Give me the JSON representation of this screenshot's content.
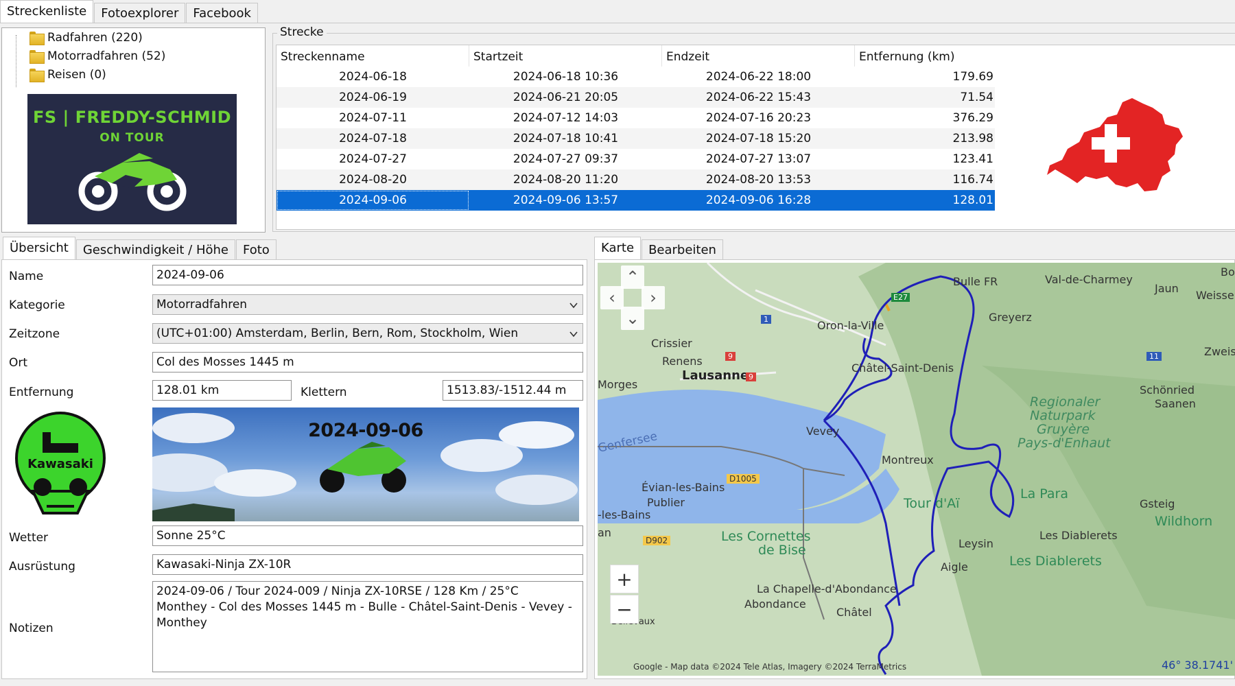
{
  "top_tabs": [
    "Streckenliste",
    "Fotoexplorer",
    "Facebook"
  ],
  "tree": {
    "items": [
      "Radfahren (220)",
      "Motorradfahren (52)",
      "Reisen (0)"
    ]
  },
  "brand": {
    "line1": "FS | FREDDY-SCHMID",
    "line2": "ON TOUR"
  },
  "strecke": {
    "group_title": "Strecke",
    "columns": [
      "Streckenname",
      "Startzeit",
      "Endzeit",
      "Entfernung (km)"
    ],
    "rows": [
      [
        "2024-06-18",
        "2024-06-18 10:36",
        "2024-06-22 18:00",
        "179.69"
      ],
      [
        "2024-06-19",
        "2024-06-21 20:05",
        "2024-06-22 15:43",
        "71.54"
      ],
      [
        "2024-07-11",
        "2024-07-12 14:03",
        "2024-07-16 20:23",
        "376.29"
      ],
      [
        "2024-07-18",
        "2024-07-18 10:41",
        "2024-07-18 15:20",
        "213.98"
      ],
      [
        "2024-07-27",
        "2024-07-27 09:37",
        "2024-07-27 13:07",
        "123.41"
      ],
      [
        "2024-08-20",
        "2024-08-20 11:20",
        "2024-08-20 13:53",
        "116.74"
      ],
      [
        "2024-09-06",
        "2024-09-06 13:57",
        "2024-09-06 16:28",
        "128.01"
      ]
    ],
    "selected_index": 6
  },
  "detail_tabs": [
    "Übersicht",
    "Geschwindigkeit / Höhe",
    "Foto"
  ],
  "detail": {
    "name_label": "Name",
    "name_value": "2024-09-06",
    "kategorie_label": "Kategorie",
    "kategorie_value": "Motorradfahren",
    "zeitzone_label": "Zeitzone",
    "zeitzone_value": "(UTC+01:00) Amsterdam, Berlin, Bern, Rom, Stockholm, Wien",
    "ort_label": "Ort",
    "ort_value": "Col des Mosses 1445 m",
    "entfernung_label": "Entfernung",
    "entfernung_value": "128.01 km",
    "klettern_label": "Klettern",
    "klettern_value": "1513.83/-1512.44 m",
    "banner_title": "2024-09-06",
    "kawasaki_text": "Kawasaki",
    "wetter_label": "Wetter",
    "wetter_value": "Sonne 25°C",
    "ausruestung_label": "Ausrüstung",
    "ausruestung_value": "Kawasaki-Ninja ZX-10R",
    "notizen_label": "Notizen",
    "notizen_line1": "2024-09-06 / Tour 2024-009 / Ninja ZX-10RSE / 128 Km / 25°C",
    "notizen_line2": "Monthey - Col des Mosses 1445 m - Bulle - Châtel-Saint-Denis - Vevey - Monthey"
  },
  "map_tabs": [
    "Karte",
    "Bearbeiten"
  ],
  "map": {
    "places": {
      "bulle": "Bulle FR",
      "val_de_charmey": "Val-de-Charmey",
      "jaun": "Jaun",
      "weissenb": "Weissenb",
      "bol": "Bol",
      "greyerz": "Greyerz",
      "oron": "Oron-la-Ville",
      "crissier": "Crissier",
      "renens": "Renens",
      "lausanne": "Lausanne",
      "morges": "Morges",
      "chatel": "Châtel-Saint-Denis",
      "zweisim": "Zweisim",
      "schoenried": "Schönried",
      "saanen": "Saanen",
      "regional1": "Regionaler",
      "regional2": "Naturpark",
      "regional3": "Gruyère",
      "regional4": "Pays-d'Enhaut",
      "vevey": "Vevey",
      "genfersee": "Genfersee",
      "montreux": "Montreux",
      "evian": "Évian-les-Bains",
      "publier": "Publier",
      "les_bains": "-les-Bains",
      "an": "an",
      "tour_dai": "Tour d'Aï",
      "la_para": "La Para",
      "gsteig": "Gsteig",
      "wildhorn": "Wildhorn",
      "cornettes1": "Les Cornettes",
      "cornettes2": "de Bise",
      "diablerets_town": "Les Diablerets",
      "diablerets_peak": "Les Diablerets",
      "leysin": "Leysin",
      "aigle": "Aigle",
      "chapelle": "La Chapelle-d'Abondance",
      "abondance": "Abondance",
      "chatel_fr": "Châtel",
      "d1005": "D1005",
      "d902": "D902",
      "r9a": "9",
      "r9b": "9",
      "r1": "1",
      "r11": "11",
      "e27": "E27",
      "bellevaux": "Bellevaux"
    },
    "attribution": "Google - Map data ©2024 Tele Atlas, Imagery ©2024 TerraMetrics",
    "coordinate": "46° 38.1741'"
  },
  "colors": {
    "selection": "#0b6bd4",
    "route": "#1f1fb8",
    "lake": "#8fb5ea",
    "flag": "#e32424",
    "brand_bg": "#262b46",
    "brand_fg": "#6fd436"
  }
}
